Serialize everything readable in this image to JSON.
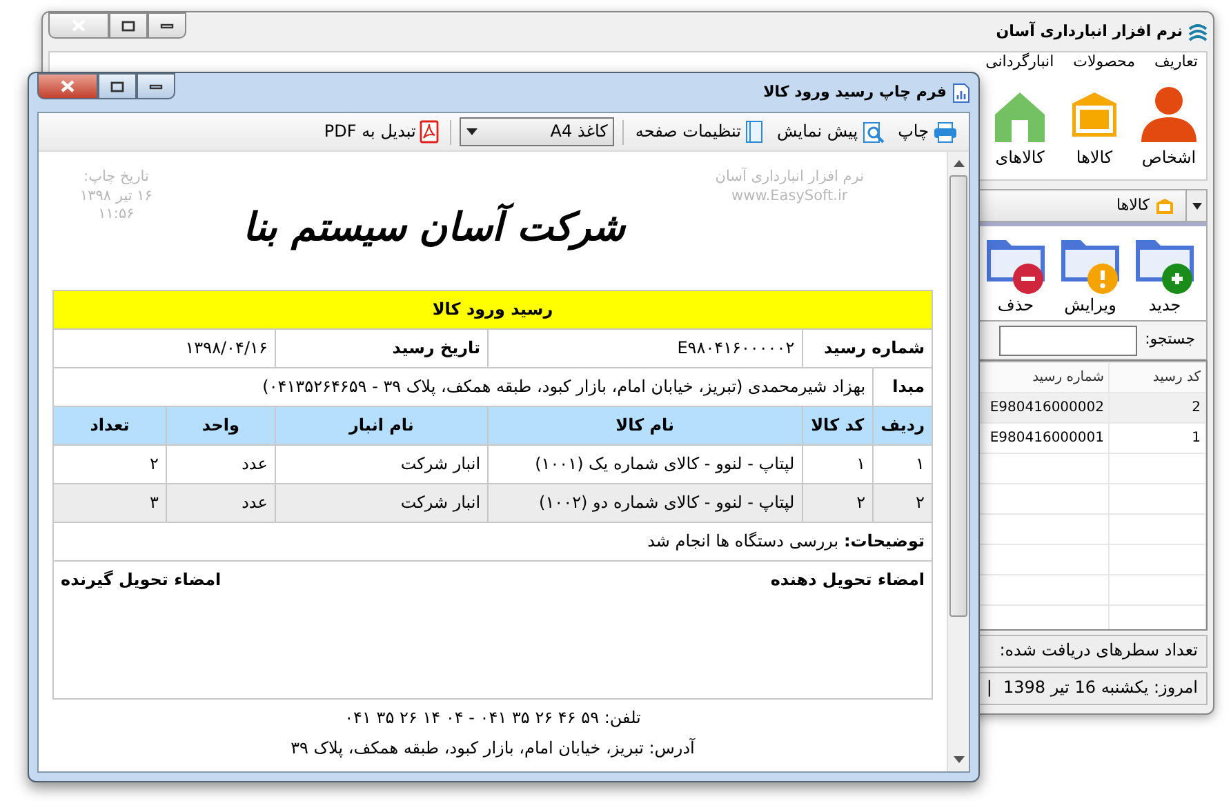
{
  "main_window": {
    "title": "نرم افزار انبارداری آسان",
    "menu": [
      {
        "label": "تعاریف"
      },
      {
        "label": "محصولات"
      },
      {
        "label": "انبارگردانی"
      }
    ],
    "ribbon": [
      {
        "label": "اشخاص",
        "kind": "person"
      },
      {
        "label": "کالاها",
        "kind": "box"
      },
      {
        "label": "کالاهای",
        "kind": "house"
      }
    ],
    "tab": {
      "label": "کالاها"
    },
    "actions": [
      {
        "label": "جدید",
        "kind": "add"
      },
      {
        "label": "ویرایش",
        "kind": "edit"
      },
      {
        "label": "حذف",
        "kind": "delete"
      }
    ],
    "search": {
      "label": "جستجو:"
    },
    "grid": {
      "columns": [
        "کد رسید",
        "شماره رسید"
      ],
      "rows": [
        [
          "2",
          "E980416000002"
        ],
        [
          "1",
          "E980416000001"
        ]
      ]
    },
    "status": {
      "row_count": "تعداد سطرهای دریافت شده:",
      "today": "امروز: یکشنبه 16 تیر 1398",
      "separator": "|"
    }
  },
  "print_window": {
    "title": "فرم چاپ رسید ورود کالا",
    "toolbar": [
      {
        "kind": "print",
        "label": "چاپ"
      },
      {
        "kind": "preview",
        "label": "پیش نمایش"
      },
      {
        "kind": "page",
        "label": "تنظیمات صفحه"
      },
      {
        "kind": "select",
        "value": "کاغذ A4"
      },
      {
        "kind": "pdf",
        "label": "تبدیل به PDF"
      }
    ],
    "header_right": [
      "نرم افزار انبارداری آسان",
      "www.EasySoft.ir"
    ],
    "company": "شرکت آسان سیستم بنا",
    "header_left": [
      "تاریخ چاپ:",
      "۱۶ تیر ۱۳۹۸",
      "۱۱:۵۶"
    ],
    "receipt": {
      "title": "رسید ورود کالا",
      "number_label": "شماره رسید",
      "number": "E۹۸۰۴۱۶۰۰۰۰۰۲",
      "date_label": "تاریخ رسید",
      "date": "۱۳۹۸/۰۴/۱۶",
      "origin_label": "مبدا",
      "origin": "بهزاد شیرمحمدی (تبریز، خیابان امام، بازار کبود، طبقه همکف، پلاک ۳۹ - ۰۴۱۳۵۲۶۴۶۵۹)",
      "columns": [
        "ردیف",
        "کد کالا",
        "نام کالا",
        "نام انبار",
        "واحد",
        "تعداد"
      ],
      "rows": [
        [
          "۱",
          "۱",
          "لپتاپ - لنوو - کالای شماره یک (۱۰۰۱)",
          "انبار شرکت",
          "عدد",
          "۲"
        ],
        [
          "۲",
          "۲",
          "لپتاپ - لنوو - کالای شماره دو (۱۰۰۲)",
          "انبار شرکت",
          "عدد",
          "۳"
        ]
      ],
      "description_label": "توضیحات:",
      "description": "بررسی دستگاه ها انجام شد",
      "signatures": [
        "امضاء تحویل دهنده",
        "امضاء تحویل گیرنده"
      ]
    },
    "footer": [
      "تلفن: ۵۹ ۴۶ ۲۶ ۳۵ ۰۴۱ - ۰۴ ۱۴ ۲۶ ۳۵ ۰۴۱",
      "آدرس: تبریز، خیابان امام، بازار کبود، طبقه همکف، پلاک ۳۹"
    ]
  }
}
